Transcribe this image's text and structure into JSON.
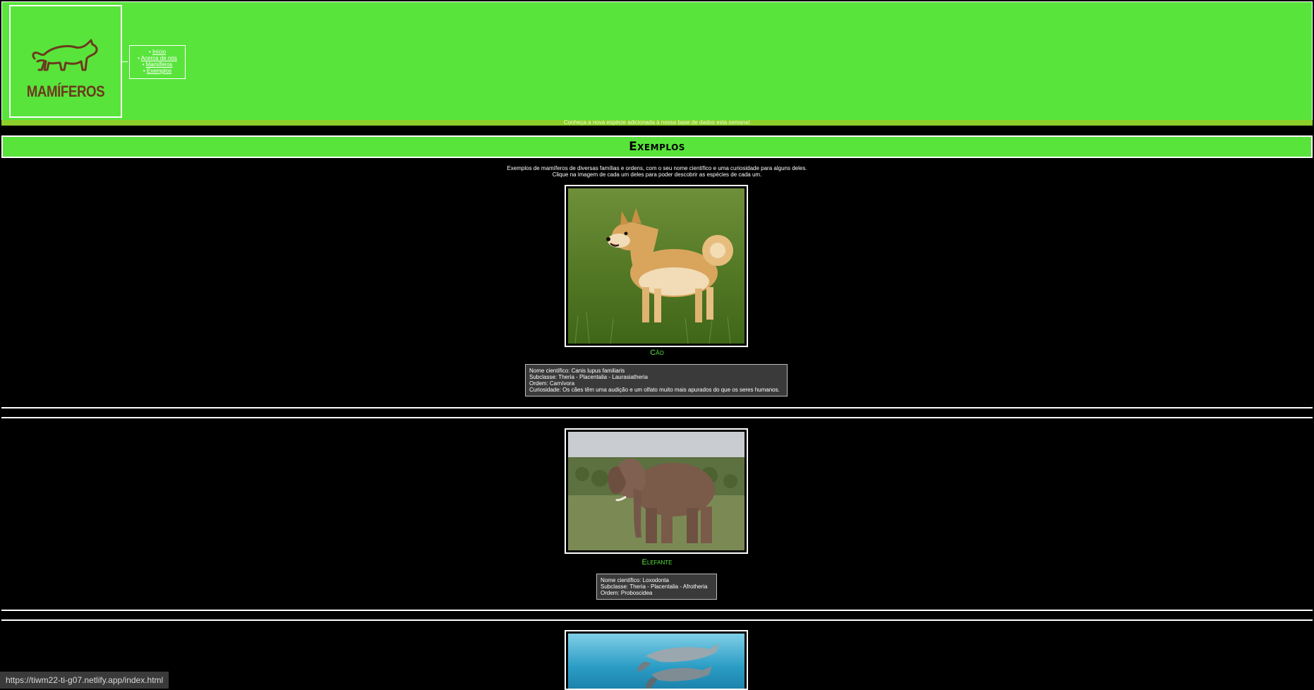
{
  "header": {
    "logo_text": "MAMÍFEROS",
    "logo_icon": "cat-silhouette-icon",
    "nav": [
      "Início",
      "Acerca de nós",
      "Mamíferos",
      "Exemplos"
    ],
    "ticker": "Conheça a nova espécie adicionada à nossa base de dados esta semana!"
  },
  "section": {
    "title": "Exemplos",
    "intro_line1": "Exemplos de mamíferos de diversas famílias e ordens, com o seu nome científico e uma curiosidade para alguns deles.",
    "intro_line2": "Clique na imagem de cada um deles para poder descobrir as espécies de cada um."
  },
  "species": [
    {
      "name": "Cão",
      "image": "dog-photo",
      "info": [
        "Nome científico: Canis lupus familiaris",
        "Subclasse: Theria - Placentalia - Laurasiatheria",
        "Ordem: Carnívora",
        "Curiosidade: Os cães têm uma audição e um olfato muito mais apurados do que os seres humanos."
      ]
    },
    {
      "name": "Elefante",
      "image": "elephant-photo",
      "info": [
        "Nome científico: Loxodonta",
        "Subclasse: Theria - Placentalia - Afrotheria",
        "Ordem: Proboscidea"
      ]
    },
    {
      "name": "",
      "image": "dolphin-photo",
      "info": []
    }
  ],
  "status_url": "https://tiwm22-ti-g07.netlify.app/index.html",
  "colors": {
    "header_green": "#58e43b",
    "ticker_bar": "#8ccf2a",
    "species_green": "#58e43b",
    "logo_brown": "#6b3a1c"
  }
}
